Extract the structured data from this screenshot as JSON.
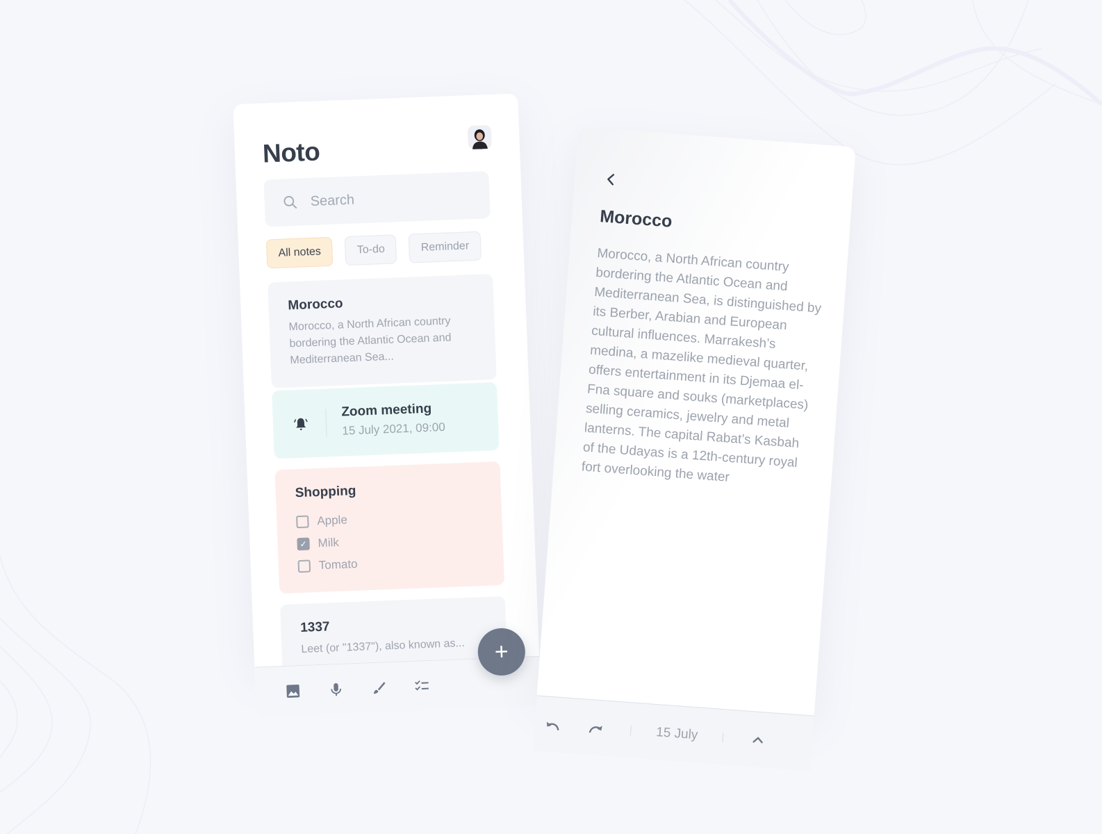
{
  "app": {
    "title": "Noto",
    "avatar_alt": "user-avatar"
  },
  "search": {
    "placeholder": "Search"
  },
  "filters": [
    {
      "label": "All notes",
      "active": true
    },
    {
      "label": "To-do",
      "active": false
    },
    {
      "label": "Reminder",
      "active": false
    }
  ],
  "notes": {
    "morocco": {
      "title": "Morocco",
      "preview": "Morocco, a North African country bordering the Atlantic Ocean and Mediterranean Sea..."
    },
    "zoom": {
      "title": "Zoom meeting",
      "datetime": "15 July 2021, 09:00",
      "icon": "bell-icon"
    },
    "shopping": {
      "title": "Shopping",
      "items": [
        {
          "label": "Apple",
          "checked": false
        },
        {
          "label": "Milk",
          "checked": true
        },
        {
          "label": "Tomato",
          "checked": false
        }
      ]
    },
    "leet": {
      "title": "1337",
      "preview": "Leet (or \"1337\"), also known as..."
    }
  },
  "toolbar": {
    "icons": [
      "image-icon",
      "microphone-icon",
      "brush-icon",
      "checklist-icon"
    ],
    "fab_label": "+"
  },
  "detail": {
    "title": "Morocco",
    "body": "Morocco, a North African country bordering the Atlantic Ocean and Mediterranean Sea, is distinguished by its Berber, Arabian and European cultural influences. Marrakesh’s medina, a mazelike medieval quarter, offers entertainment in its Djemaa el-Fna square and souks (marketplaces) selling ceramics, jewelry and metal lanterns. The capital Rabat’s Kasbah of the Udayas is a 12th-century royal fort overlooking the water",
    "date": "15 July"
  },
  "colors": {
    "background": "#f6f7fb",
    "text_dark": "#373f4c",
    "text_muted": "#9ea4af",
    "chip_active": "#fdeed8",
    "note_gray": "#f4f5f9",
    "note_teal": "#e9f8f7",
    "note_pink": "#fdeeec",
    "fab": "#6e7889"
  }
}
